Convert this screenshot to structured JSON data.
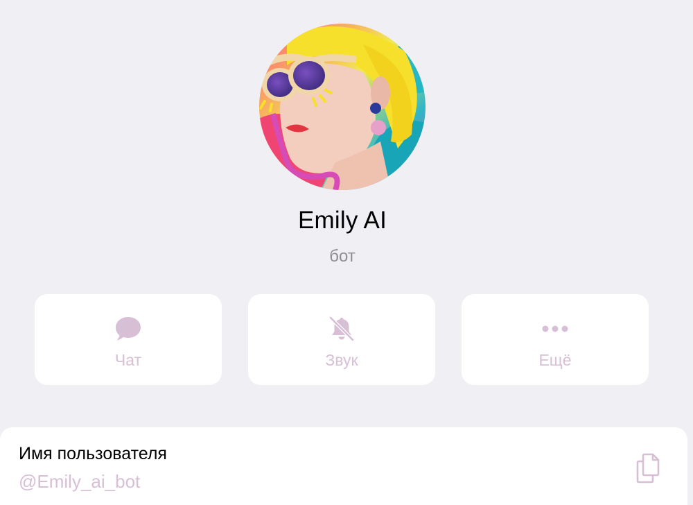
{
  "profile": {
    "name": "Emily AI",
    "status": "бот",
    "avatar": "avatar-photo"
  },
  "actions": [
    {
      "label": "Чат",
      "icon": "chat-bubble-icon"
    },
    {
      "label": "Звук",
      "icon": "bell-muted-icon"
    },
    {
      "label": "Ещё",
      "icon": "more-dots-icon"
    }
  ],
  "username": {
    "title": "Имя пользователя",
    "value": "@Emily_ai_bot",
    "copy_icon": "copy-icon"
  },
  "colors": {
    "background": "#efeff4",
    "card": "#ffffff",
    "accent": "#d7bfd6",
    "secondary_text": "#8e8e93"
  }
}
